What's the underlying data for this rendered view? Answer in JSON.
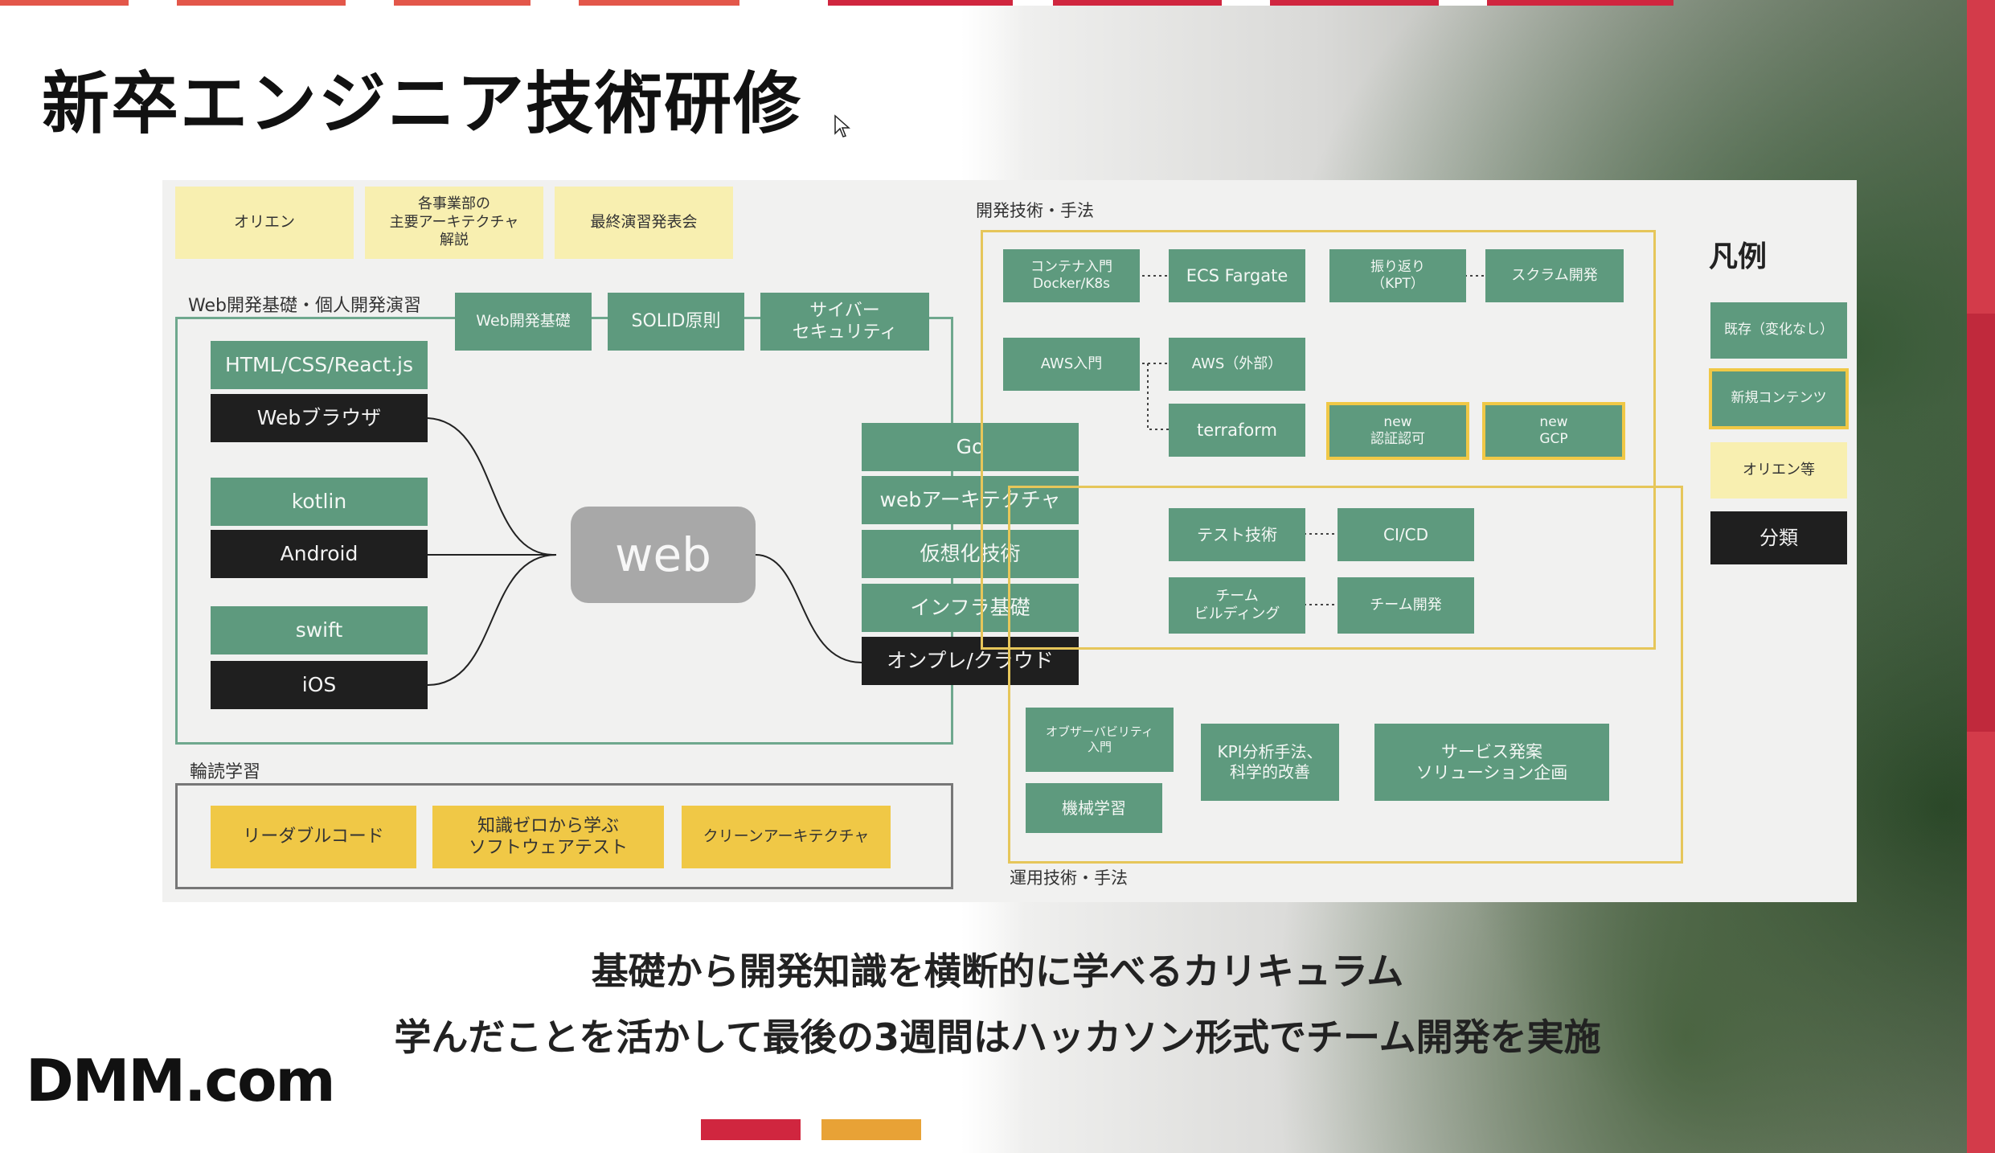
{
  "slide": {
    "title": "新卒エンジニア技術研修",
    "caption_line1": "基礎から開発知識を横断的に学べるカリキュラム",
    "caption_line2": "学んだことを活かして最後の3週間はハッカソン形式でチーム開発を実施",
    "logo": "DMM.com"
  },
  "colors": {
    "accent_red": "#d0263f",
    "accent_orange": "#e8a236",
    "green": "#5e9a7e",
    "black": "#1f1f1f",
    "light_yellow": "#f8efb0",
    "yellow": "#f0c846"
  },
  "diagram": {
    "top_boxes": [
      "オリエン",
      "各事業部の\n主要アーキテクチャ\n解説",
      "最終演習発表会"
    ],
    "web_section_label": "Web開発基礎・個人開発演習",
    "web_top": [
      "Web開発基礎",
      "SOLID原則",
      "サイバー\nセキュリティ"
    ],
    "left_stack": [
      "HTML/CSS/React.js",
      "Webブラウザ",
      "kotlin",
      "Android",
      "swift",
      "iOS"
    ],
    "hub": "web",
    "right_stack": [
      "Go",
      "webアーキテクチャ",
      "仮想化技術",
      "インフラ基礎",
      "オンプレ/クラウド"
    ],
    "reading_label": "輪読学習",
    "reading_books": [
      "リーダブルコード",
      "知識ゼロから学ぶ\nソフトウェアテスト",
      "クリーンアーキテクチャ"
    ],
    "dev_label": "開発技術・手法",
    "dev_boxes": [
      "コンテナ入門\nDocker/K8s",
      "ECS Fargate",
      "振り返り\n（KPT）",
      "スクラム開発",
      "AWS入門",
      "AWS（外部）",
      "terraform",
      "new\n認証認可",
      "new\nGCP",
      "テスト技術",
      "CI/CD",
      "チーム\nビルディング",
      "チーム開発"
    ],
    "ops_boxes": [
      "オブザーバビリティ\n入門",
      "機械学習",
      "KPI分析手法、\n科学的改善",
      "サービス発案\nソリューション企画"
    ],
    "ops_label": "運用技術・手法",
    "legend_title": "凡例",
    "legend": [
      "既存（変化なし）",
      "新規コンテンツ",
      "オリエン等",
      "分類"
    ]
  }
}
